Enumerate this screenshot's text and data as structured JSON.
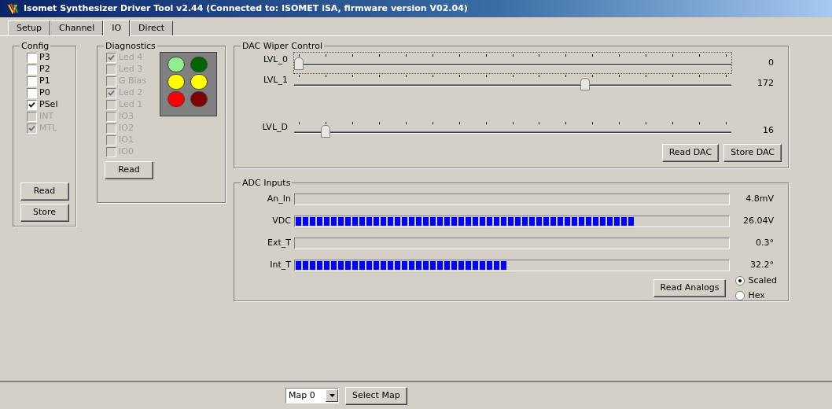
{
  "window": {
    "title": "Isomet Synthesizer Driver Tool v2.44 (Connected to: ISOMET iSA, firmware version V02.04)"
  },
  "tabs": [
    {
      "label": "Setup",
      "selected": false
    },
    {
      "label": "Channel",
      "selected": false
    },
    {
      "label": "IO",
      "selected": true
    },
    {
      "label": "Direct",
      "selected": false
    }
  ],
  "config": {
    "title": "Config",
    "checkboxes": [
      {
        "label": "P3",
        "checked": false,
        "disabled": false
      },
      {
        "label": "P2",
        "checked": false,
        "disabled": false
      },
      {
        "label": "P1",
        "checked": false,
        "disabled": false
      },
      {
        "label": "P0",
        "checked": false,
        "disabled": false
      },
      {
        "label": "PSel",
        "checked": true,
        "disabled": false
      },
      {
        "label": "INT",
        "checked": false,
        "disabled": true
      },
      {
        "label": "MTL",
        "checked": true,
        "disabled": true
      }
    ],
    "buttons": [
      "Read",
      "Store"
    ]
  },
  "diagnostics": {
    "title": "Diagnostics",
    "checkboxes": [
      {
        "label": "Led 4",
        "checked": true,
        "disabled": true
      },
      {
        "label": "Led 3",
        "checked": false,
        "disabled": true
      },
      {
        "label": "G Bias",
        "checked": false,
        "disabled": true
      },
      {
        "label": "Led 2",
        "checked": true,
        "disabled": true
      },
      {
        "label": "Led 1",
        "checked": false,
        "disabled": true
      },
      {
        "label": "IO3",
        "checked": false,
        "disabled": true
      },
      {
        "label": "IO2",
        "checked": false,
        "disabled": true
      },
      {
        "label": "IO1",
        "checked": false,
        "disabled": true
      },
      {
        "label": "IO0",
        "checked": false,
        "disabled": true
      }
    ],
    "leds": [
      {
        "color": "#90ee90"
      },
      {
        "color": "#006400"
      },
      {
        "color": "#ffff00"
      },
      {
        "color": "#ffff00"
      },
      {
        "color": "#ff0000"
      },
      {
        "color": "#800000"
      }
    ],
    "button": "Read"
  },
  "dac": {
    "title": "DAC Wiper Control",
    "sliders": [
      {
        "label": "LVL_0",
        "level": 0,
        "reading": "0",
        "focused": true
      },
      {
        "label": "LVL_1",
        "level": 0.67,
        "reading": "172",
        "focused": false
      },
      {
        "label": "LVL_D",
        "level": 0.063,
        "reading": "16",
        "focused": false
      }
    ],
    "buttons": [
      "Read DAC",
      "Store DAC"
    ]
  },
  "adc": {
    "title": "ADC Inputs",
    "meters": [
      {
        "label": "An_In",
        "reading": "4.8mV"
      },
      {
        "label": "VDC",
        "level": 0.785,
        "reading": "26.04V"
      },
      {
        "label": "Ext_T",
        "reading": "0.3°"
      },
      {
        "label": "Int_T",
        "level": 0.487,
        "reading": "32.2°"
      }
    ],
    "button": "Read Analogs",
    "radios": [
      {
        "label": "Scaled",
        "selected": true
      },
      {
        "label": "Hex",
        "selected": false
      }
    ]
  },
  "bottom": {
    "map_select": {
      "value": "Map 0"
    },
    "button": "Select Map"
  }
}
